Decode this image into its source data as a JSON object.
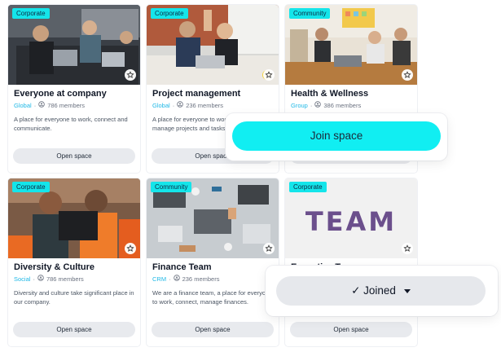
{
  "cards": [
    {
      "tag": "Corporate",
      "title": "Everyone at company",
      "kind": "Global",
      "members": "786 members",
      "desc": "A place for everyone to work, connect and communicate.",
      "button": "Open space"
    },
    {
      "tag": "Corporate",
      "title": "Project management",
      "kind": "Global",
      "members": "236 members",
      "desc": "A place for everyone to work, connect and manage projects and tasks.",
      "button": "Open space"
    },
    {
      "tag": "Community",
      "title": "Health & Wellness",
      "kind": "Group",
      "members": "386 members",
      "desc": "",
      "button": "Open space"
    },
    {
      "tag": "Corporate",
      "title": "Diversity & Culture",
      "kind": "Social",
      "members": "786 members",
      "desc": "Diversity and culture take significant place in our company.",
      "button": "Open space"
    },
    {
      "tag": "Community",
      "title": "Finance Team",
      "kind": "CRM",
      "members": "236 members",
      "desc": "We are a finance team, a place for everyone to work, connect, manage finances.",
      "button": "Open space"
    },
    {
      "tag": "Corporate",
      "title": "Executive Team",
      "kind": "",
      "members": "",
      "desc": "",
      "button": "Open space",
      "image_text": "TEAM"
    }
  ],
  "join_button": "Join space",
  "joined_button": "✓ Joined",
  "colors": {
    "accent": "#14e5ea",
    "kind_text": "#1fb8e6",
    "button_bg": "#e8eaee"
  }
}
